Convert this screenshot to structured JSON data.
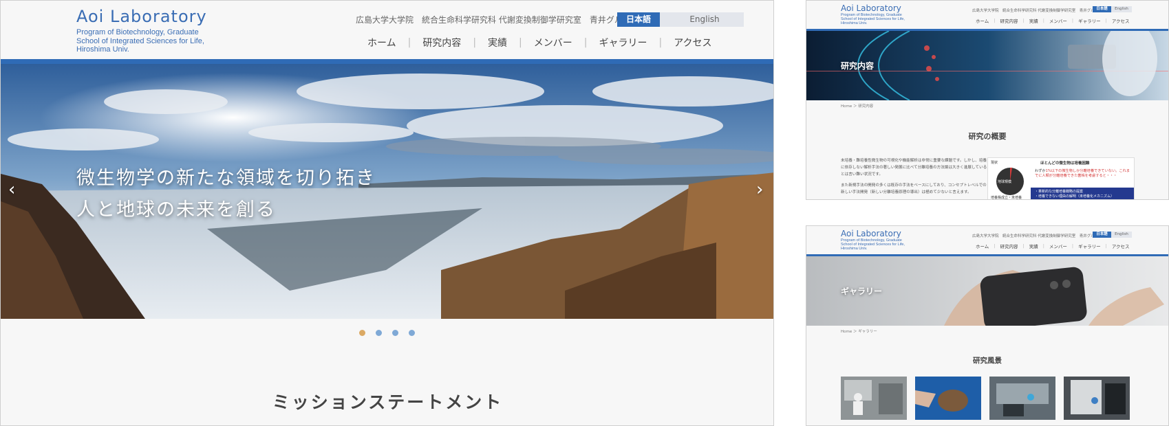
{
  "header": {
    "logo_title": "Aoi Laboratory",
    "logo_sub_1": "Program of Biotechnology, Graduate",
    "logo_sub_2": "School of Integrated Sciences for Life,",
    "logo_sub_3": "Hiroshima Univ.",
    "affiliation": "広島大学大学院　統合生命科学研究科 代謝変換制御学研究室　青井グループ",
    "lang_ja": "日本語",
    "lang_en": "English",
    "nav": [
      "ホーム",
      "研究内容",
      "実績",
      "メンバー",
      "ギャラリー",
      "アクセス"
    ]
  },
  "hero": {
    "line1": "微生物学の新たな領域を切り拓き",
    "line2": "人と地球の未来を創る",
    "prev_arrow": "‹",
    "next_arrow": "›",
    "slides": 4,
    "active_slide": 1
  },
  "mission_heading": "ミッションステートメント",
  "research_page": {
    "small_affiliation": "広島大学大学院　統合生命科学研究科 代謝変換制御学研究室　青井グループ",
    "banner_title": "研究内容",
    "breadcrumb": "Home ＞ 研究内容",
    "heading": "研究の概要",
    "para1": "未培養・難培養性微生物の可視化や機能解析は非常に重要な課題です。しかし、培養に依存しない解析手法の著しい発展に比べて分離培養の方法論は大きく進展しているとは言い難い状況です。",
    "para2": "また新規手法の開発の多くは既存の手法をベースにしており、コンセプトレベルでの新しい手法開発（新しい分離培養原理の導出）は極めて少ないと言えます。",
    "figure": {
      "label_now": "現状",
      "label_circle": "地球規模",
      "label_bottom": "培養株成立・未培養",
      "title": "ほとんどの微生物は培養困難",
      "note_prefix": "わずか",
      "note_red": "1%以下の微生物しか分離培養できていない。これまでに人類が分離培養できた菌株を考慮すると・・・",
      "bar_line1": "・革新的な分離培養戦略の提案",
      "bar_line2": "・培養できない理由の解明（未培養化メカニズム）"
    }
  },
  "gallery_page": {
    "banner_title": "ギャラリー",
    "breadcrumb": "Home ＞ ギャラリー",
    "heading": "研究風景"
  },
  "colors": {
    "brand_blue": "#2f6bb6",
    "dot_active": "#dba964",
    "dot_inactive": "#7fa9d6"
  }
}
